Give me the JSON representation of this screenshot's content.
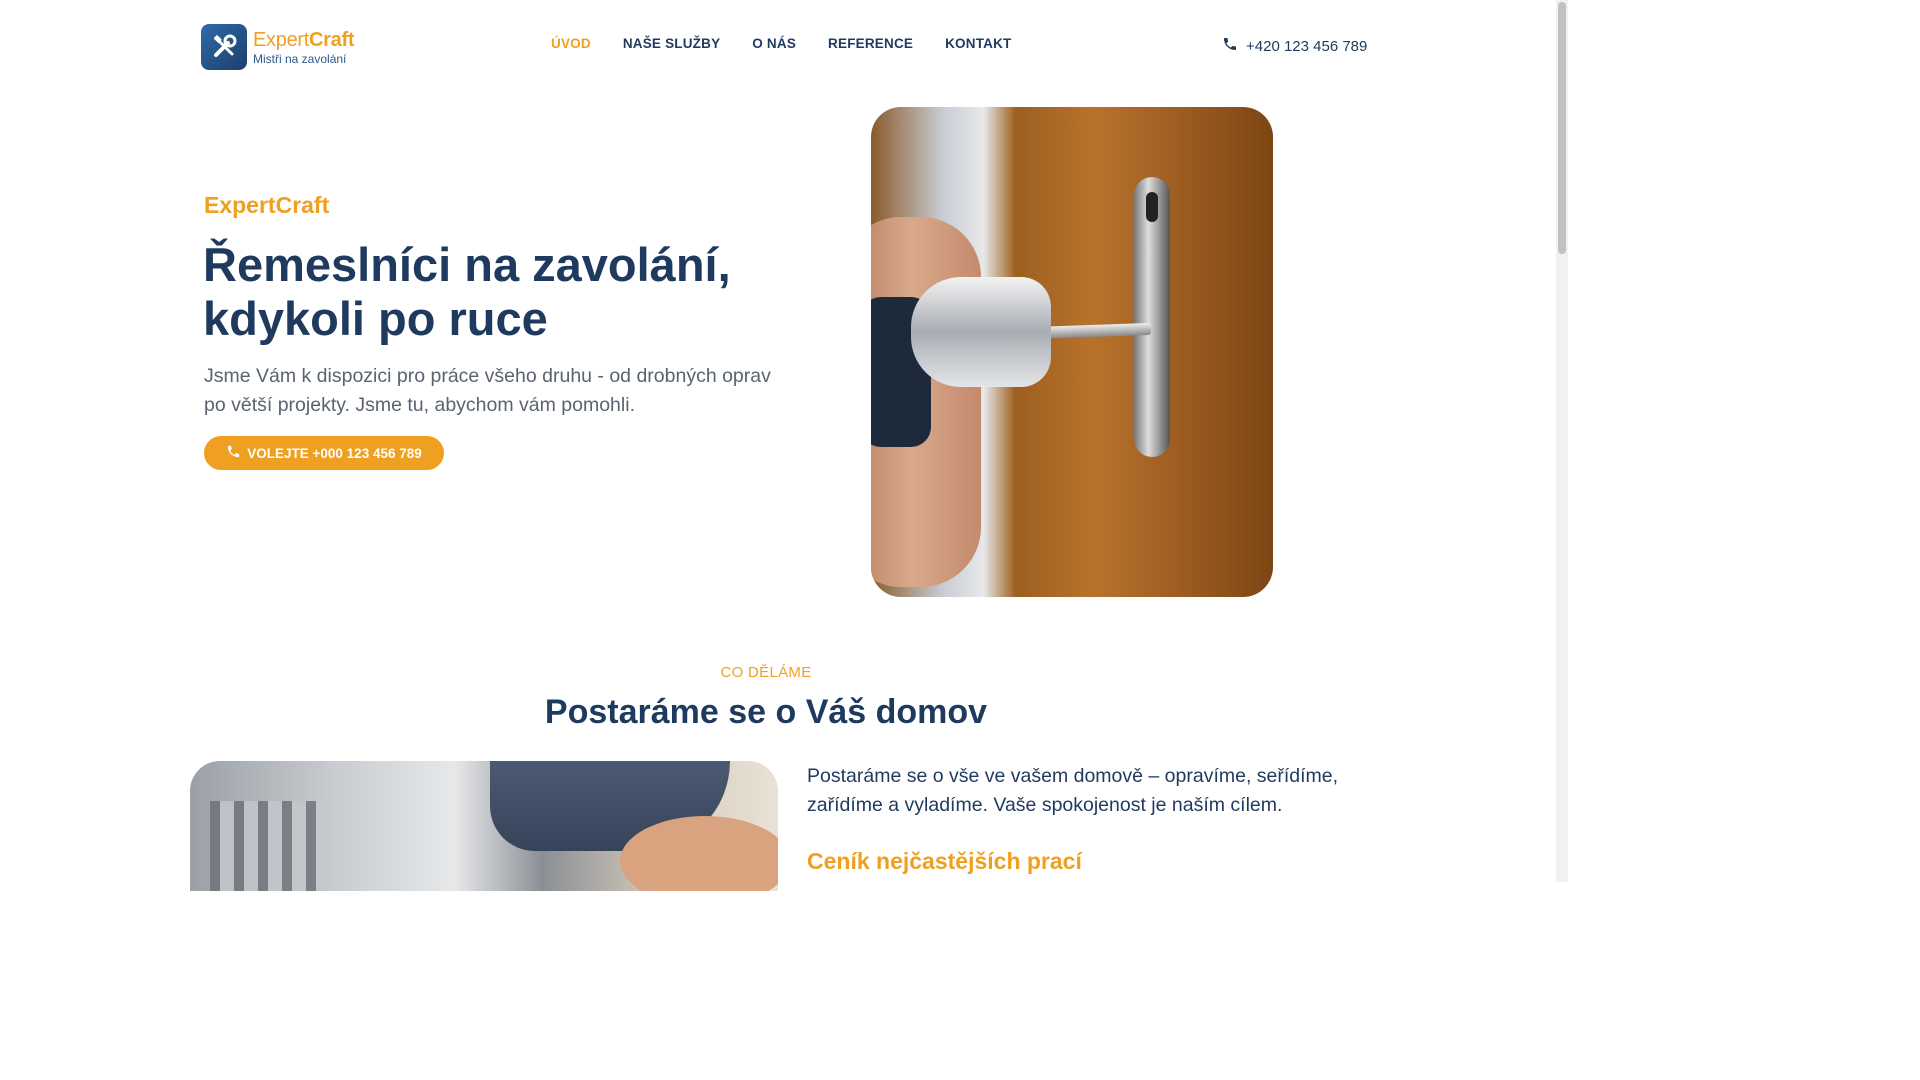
{
  "header": {
    "logo": {
      "name_light": "Expert",
      "name_bold": "Craft",
      "tagline": "Mistři na zavolání"
    },
    "nav": [
      {
        "label": "ÚVOD",
        "active": true
      },
      {
        "label": "NAŠE SLUŽBY",
        "active": false
      },
      {
        "label": "O NÁS",
        "active": false
      },
      {
        "label": "REFERENCE",
        "active": false
      },
      {
        "label": "KONTAKT",
        "active": false
      }
    ],
    "phone": "+420 123 456 789"
  },
  "hero": {
    "eyebrow": "ExpertCraft",
    "title_line1": "Řemeslníci na zavolání,",
    "title_line2": "kdykoli po ruce",
    "text": "Jsme Vám k dispozici pro práce všeho druhu - od drobných oprav po větší projekty. Jsme tu, abychom vám pomohli.",
    "cta_label": "VOLEJTE +000 123 456 789"
  },
  "section": {
    "eyebrow": "CO DĚLÁME",
    "title": "Postaráme se o Váš domov",
    "text": "Postaráme se o vše ve vašem domově – opravíme, seřídíme, zařídíme a vyladíme. Vaše spokojenost je naším cílem.",
    "subtitle": "Ceník nejčastějších prací"
  },
  "colors": {
    "accent": "#f0a020",
    "primary": "#1f3a5f",
    "muted": "#5a6372"
  },
  "icons": {
    "logo": "tools-icon",
    "phone": "phone-icon"
  }
}
